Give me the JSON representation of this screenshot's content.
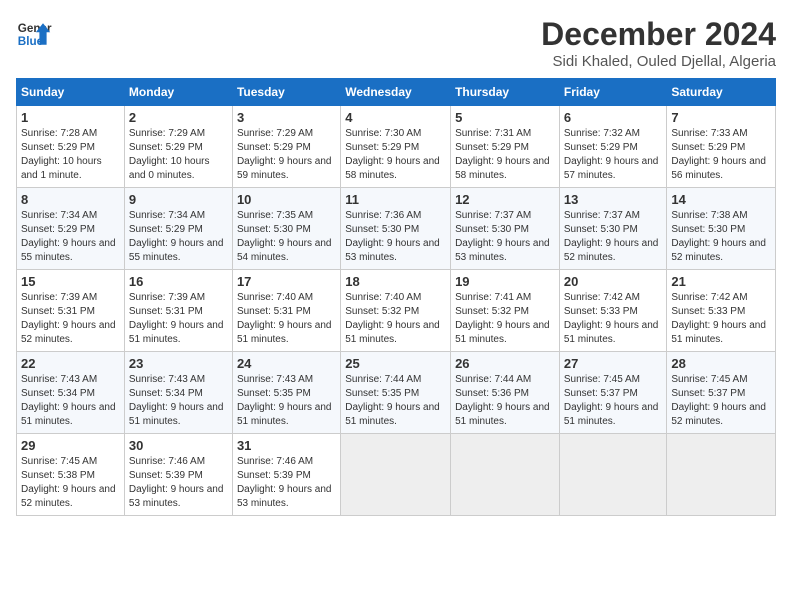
{
  "header": {
    "logo_line1": "General",
    "logo_line2": "Blue",
    "month": "December 2024",
    "location": "Sidi Khaled, Ouled Djellal, Algeria"
  },
  "days_of_week": [
    "Sunday",
    "Monday",
    "Tuesday",
    "Wednesday",
    "Thursday",
    "Friday",
    "Saturday"
  ],
  "weeks": [
    [
      {
        "day": "1",
        "info": "Sunrise: 7:28 AM\nSunset: 5:29 PM\nDaylight: 10 hours and 1 minute."
      },
      {
        "day": "2",
        "info": "Sunrise: 7:29 AM\nSunset: 5:29 PM\nDaylight: 10 hours and 0 minutes."
      },
      {
        "day": "3",
        "info": "Sunrise: 7:29 AM\nSunset: 5:29 PM\nDaylight: 9 hours and 59 minutes."
      },
      {
        "day": "4",
        "info": "Sunrise: 7:30 AM\nSunset: 5:29 PM\nDaylight: 9 hours and 58 minutes."
      },
      {
        "day": "5",
        "info": "Sunrise: 7:31 AM\nSunset: 5:29 PM\nDaylight: 9 hours and 58 minutes."
      },
      {
        "day": "6",
        "info": "Sunrise: 7:32 AM\nSunset: 5:29 PM\nDaylight: 9 hours and 57 minutes."
      },
      {
        "day": "7",
        "info": "Sunrise: 7:33 AM\nSunset: 5:29 PM\nDaylight: 9 hours and 56 minutes."
      }
    ],
    [
      {
        "day": "8",
        "info": "Sunrise: 7:34 AM\nSunset: 5:29 PM\nDaylight: 9 hours and 55 minutes."
      },
      {
        "day": "9",
        "info": "Sunrise: 7:34 AM\nSunset: 5:29 PM\nDaylight: 9 hours and 55 minutes."
      },
      {
        "day": "10",
        "info": "Sunrise: 7:35 AM\nSunset: 5:30 PM\nDaylight: 9 hours and 54 minutes."
      },
      {
        "day": "11",
        "info": "Sunrise: 7:36 AM\nSunset: 5:30 PM\nDaylight: 9 hours and 53 minutes."
      },
      {
        "day": "12",
        "info": "Sunrise: 7:37 AM\nSunset: 5:30 PM\nDaylight: 9 hours and 53 minutes."
      },
      {
        "day": "13",
        "info": "Sunrise: 7:37 AM\nSunset: 5:30 PM\nDaylight: 9 hours and 52 minutes."
      },
      {
        "day": "14",
        "info": "Sunrise: 7:38 AM\nSunset: 5:30 PM\nDaylight: 9 hours and 52 minutes."
      }
    ],
    [
      {
        "day": "15",
        "info": "Sunrise: 7:39 AM\nSunset: 5:31 PM\nDaylight: 9 hours and 52 minutes."
      },
      {
        "day": "16",
        "info": "Sunrise: 7:39 AM\nSunset: 5:31 PM\nDaylight: 9 hours and 51 minutes."
      },
      {
        "day": "17",
        "info": "Sunrise: 7:40 AM\nSunset: 5:31 PM\nDaylight: 9 hours and 51 minutes."
      },
      {
        "day": "18",
        "info": "Sunrise: 7:40 AM\nSunset: 5:32 PM\nDaylight: 9 hours and 51 minutes."
      },
      {
        "day": "19",
        "info": "Sunrise: 7:41 AM\nSunset: 5:32 PM\nDaylight: 9 hours and 51 minutes."
      },
      {
        "day": "20",
        "info": "Sunrise: 7:42 AM\nSunset: 5:33 PM\nDaylight: 9 hours and 51 minutes."
      },
      {
        "day": "21",
        "info": "Sunrise: 7:42 AM\nSunset: 5:33 PM\nDaylight: 9 hours and 51 minutes."
      }
    ],
    [
      {
        "day": "22",
        "info": "Sunrise: 7:43 AM\nSunset: 5:34 PM\nDaylight: 9 hours and 51 minutes."
      },
      {
        "day": "23",
        "info": "Sunrise: 7:43 AM\nSunset: 5:34 PM\nDaylight: 9 hours and 51 minutes."
      },
      {
        "day": "24",
        "info": "Sunrise: 7:43 AM\nSunset: 5:35 PM\nDaylight: 9 hours and 51 minutes."
      },
      {
        "day": "25",
        "info": "Sunrise: 7:44 AM\nSunset: 5:35 PM\nDaylight: 9 hours and 51 minutes."
      },
      {
        "day": "26",
        "info": "Sunrise: 7:44 AM\nSunset: 5:36 PM\nDaylight: 9 hours and 51 minutes."
      },
      {
        "day": "27",
        "info": "Sunrise: 7:45 AM\nSunset: 5:37 PM\nDaylight: 9 hours and 51 minutes."
      },
      {
        "day": "28",
        "info": "Sunrise: 7:45 AM\nSunset: 5:37 PM\nDaylight: 9 hours and 52 minutes."
      }
    ],
    [
      {
        "day": "29",
        "info": "Sunrise: 7:45 AM\nSunset: 5:38 PM\nDaylight: 9 hours and 52 minutes."
      },
      {
        "day": "30",
        "info": "Sunrise: 7:46 AM\nSunset: 5:39 PM\nDaylight: 9 hours and 53 minutes."
      },
      {
        "day": "31",
        "info": "Sunrise: 7:46 AM\nSunset: 5:39 PM\nDaylight: 9 hours and 53 minutes."
      },
      null,
      null,
      null,
      null
    ]
  ]
}
